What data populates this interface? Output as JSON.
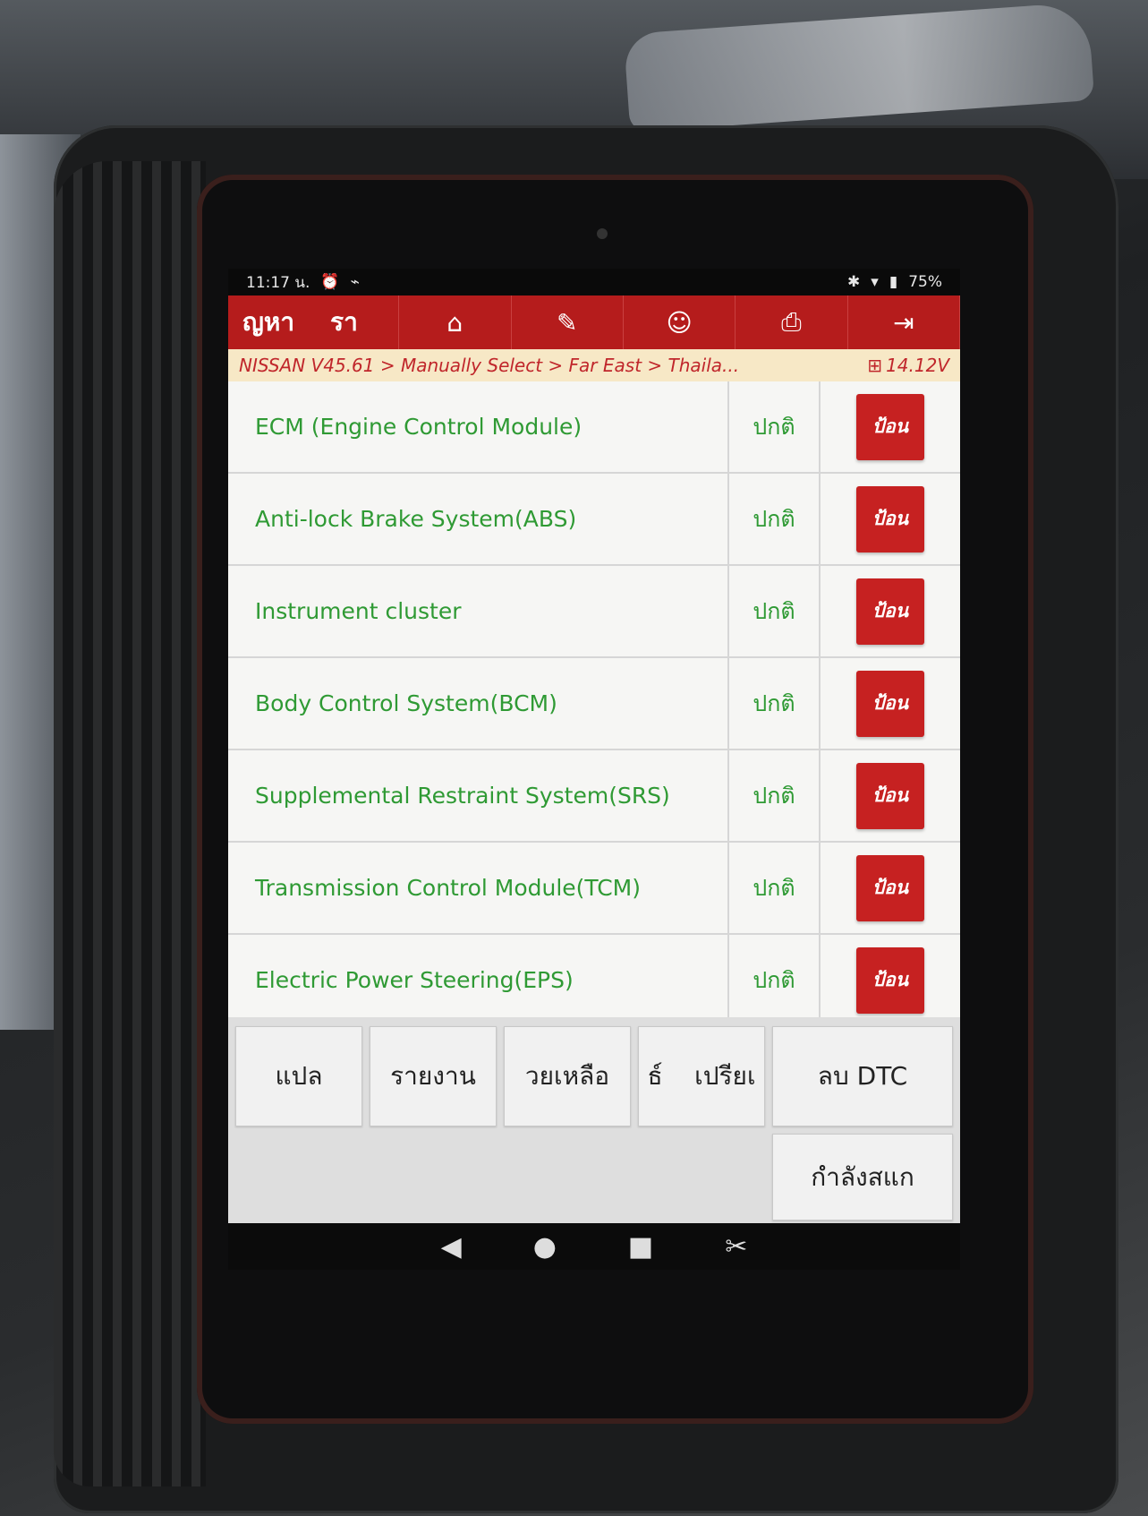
{
  "status_bar": {
    "time": "11:17 น.",
    "battery": "75%",
    "icons": [
      "alarm-icon",
      "usb-icon",
      "bluetooth-icon",
      "wifi-icon",
      "battery-icon"
    ]
  },
  "toolbar": {
    "title_part1": "ญหา",
    "title_part2": "รา",
    "icons": [
      "home-icon",
      "edit-icon",
      "profile-icon",
      "print-icon",
      "exit-icon"
    ]
  },
  "breadcrumb": {
    "path": "NISSAN V45.61 > Manually Select > Far East > Thaila...",
    "voltage": "14.12V"
  },
  "systems": [
    {
      "name": "ECM (Engine Control Module)",
      "status": "ปกติ",
      "action": "ป้อน"
    },
    {
      "name": "Anti-lock Brake System(ABS)",
      "status": "ปกติ",
      "action": "ป้อน"
    },
    {
      "name": "Instrument cluster",
      "status": "ปกติ",
      "action": "ป้อน"
    },
    {
      "name": "Body Control System(BCM)",
      "status": "ปกติ",
      "action": "ป้อน"
    },
    {
      "name": "Supplemental Restraint System(SRS)",
      "status": "ปกติ",
      "action": "ป้อน"
    },
    {
      "name": "Transmission Control Module(TCM)",
      "status": "ปกติ",
      "action": "ป้อน"
    },
    {
      "name": "Electric Power Steering(EPS)",
      "status": "ปกติ",
      "action": "ป้อน"
    }
  ],
  "function_buttons": {
    "translate": "แปล",
    "report": "รายงาน",
    "help": "วยเหลือ",
    "compare": "ธ์    เปรียเ",
    "clear_dtc": "ลบ DTC",
    "scanning": "กำลังสแก"
  },
  "colors": {
    "accent_red": "#b51c1c",
    "status_green": "#2f9a34",
    "breadcrumb_bg": "#f7e8c6"
  }
}
